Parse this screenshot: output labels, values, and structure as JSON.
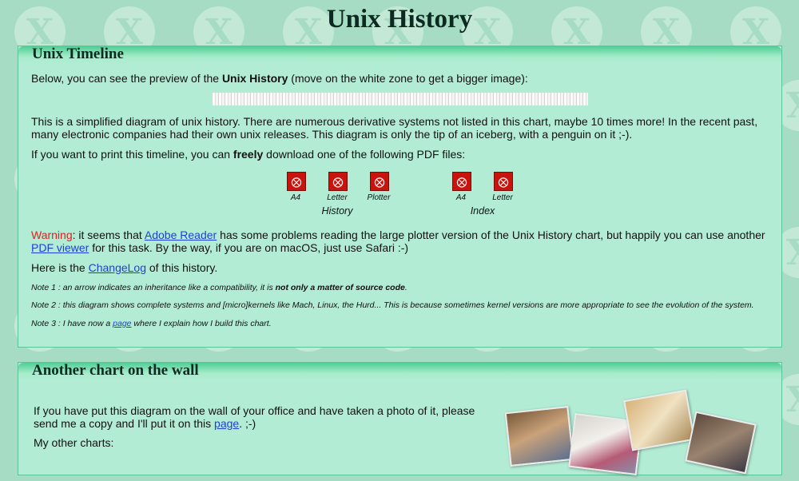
{
  "page": {
    "title": "Unix History"
  },
  "timeline": {
    "heading": "Unix Timeline",
    "preview_text_1": "Below, you can see the preview of the ",
    "preview_text_bold": "Unix History",
    "preview_text_2": " (move on the white zone to get a bigger image):",
    "simplified": "This is a simplified diagram of unix history. There are numerous derivative systems not listed in this chart, maybe 10 times more! In the recent past, many electronic companies had their own unix releases. This diagram is only the tip of an iceberg, with a penguin on it ;-).",
    "print_1": "If you want to print this timeline, you can ",
    "print_bold": "freely",
    "print_2": " download one of the following PDF files:",
    "pdf_history": [
      {
        "label": "A4",
        "icon": "pdf-icon"
      },
      {
        "label": "Letter",
        "icon": "pdf-icon"
      },
      {
        "label": "Plotter",
        "icon": "pdf-icon"
      }
    ],
    "pdf_history_group": "History",
    "pdf_index": [
      {
        "label": "A4",
        "icon": "pdf-icon"
      },
      {
        "label": "Letter",
        "icon": "pdf-icon"
      }
    ],
    "pdf_index_group": "Index",
    "warning_label": "Warning",
    "warning_1": ": it seems that ",
    "warning_link_reader": "Adobe Reader",
    "warning_2": " has some problems reading the large plotter version of the Unix History chart, but happily you can use another ",
    "warning_link_viewer": "PDF viewer",
    "warning_3": " for this task. By the way, if you are on macOS, just use Safari :-)",
    "changelog_1": "Here is the ",
    "changelog_link": "ChangeLog",
    "changelog_2": " of this history.",
    "note1_1": "Note 1 : an arrow indicates an inheritance like a compatibility, it is ",
    "note1_bold": "not only a matter of source code",
    "note1_2": ".",
    "note2": "Note 2 : this diagram shows complete systems and [micro]kernels like Mach, Linux, the Hurd... This is because sometimes kernel versions are more appropriate to see the evolution of the system.",
    "note3_1": "Note 3 : I have now a ",
    "note3_link": "page",
    "note3_2": " where I explain how I build this chart."
  },
  "wall": {
    "heading": "Another chart on the wall",
    "text_1": "If you have put this diagram on the wall of your office and have taken a photo of it, please send me a copy and I'll put it on this ",
    "text_link": "page",
    "text_2": ". ;-)",
    "other_charts": "My other charts:"
  },
  "colors": {
    "background": "#a7dcc4",
    "panel": "#b2ecd4",
    "panel_border": "#5cc39a",
    "warning": "#e02020",
    "link": "#1f3fd8",
    "pdf_icon": "#c8140c"
  }
}
